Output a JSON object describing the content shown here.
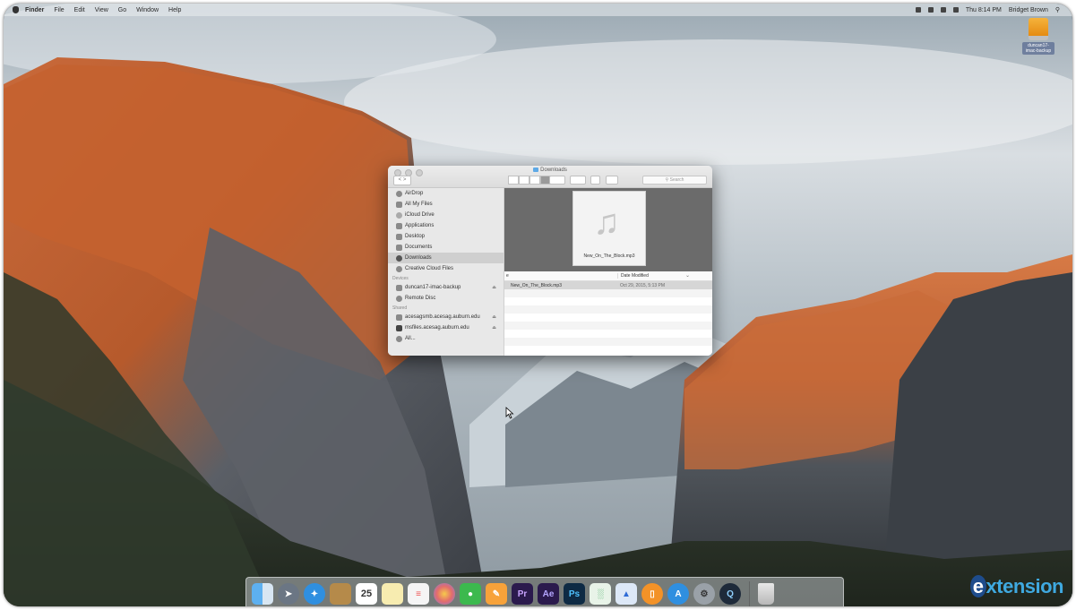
{
  "menubar": {
    "app": "Finder",
    "items": [
      "File",
      "Edit",
      "View",
      "Go",
      "Window",
      "Help"
    ],
    "clock": "Thu 8:14 PM",
    "user": "Bridget Brown"
  },
  "desktop": {
    "drive_label": "duncan17-imac-backup"
  },
  "finder": {
    "title": "Downloads",
    "search_placeholder": "Search",
    "nav_back": "<",
    "nav_forward": ">",
    "sidebar": {
      "favorites": [
        {
          "label": "AirDrop",
          "icon": "airdrop-icon"
        },
        {
          "label": "All My Files",
          "icon": "all-files-icon"
        },
        {
          "label": "iCloud Drive",
          "icon": "cloud-icon"
        },
        {
          "label": "Applications",
          "icon": "applications-icon"
        },
        {
          "label": "Desktop",
          "icon": "desktop-icon"
        },
        {
          "label": "Documents",
          "icon": "documents-icon"
        },
        {
          "label": "Downloads",
          "icon": "downloads-icon"
        },
        {
          "label": "Creative Cloud Files",
          "icon": "creative-cloud-icon"
        }
      ],
      "devices_header": "Devices",
      "devices": [
        {
          "label": "duncan17-imac-backup",
          "icon": "drive-icon"
        },
        {
          "label": "Remote Disc",
          "icon": "disc-icon"
        }
      ],
      "shared_header": "Shared",
      "shared": [
        {
          "label": "acesagsmb.acesag.auburn.edu",
          "icon": "server-icon"
        },
        {
          "label": "msfiles.acesag.auburn.edu",
          "icon": "server-icon"
        },
        {
          "label": "All...",
          "icon": "network-icon"
        }
      ]
    },
    "preview_filename": "New_On_The_Block.mp3",
    "columns": {
      "name": "e",
      "date": "Date Modified"
    },
    "files": [
      {
        "name": "New_On_The_Block.mp3",
        "date": "Oct 29, 2015, 5:13 PM"
      }
    ]
  },
  "dock": {
    "apps": [
      "Finder",
      "Launchpad",
      "Safari",
      "Contacts",
      "Calendar",
      "Notes",
      "Reminders",
      "Photos",
      "FaceTime",
      "Pages",
      "Premiere",
      "After Effects",
      "Photoshop",
      "Numbers",
      "Keynote",
      "iBooks",
      "App Store",
      "System Preferences",
      "QuickTime",
      "Trash"
    ],
    "calendar_day": "25",
    "pr_label": "Pr",
    "ae_label": "Ae",
    "ps_label": "Ps"
  },
  "watermark": "extension"
}
